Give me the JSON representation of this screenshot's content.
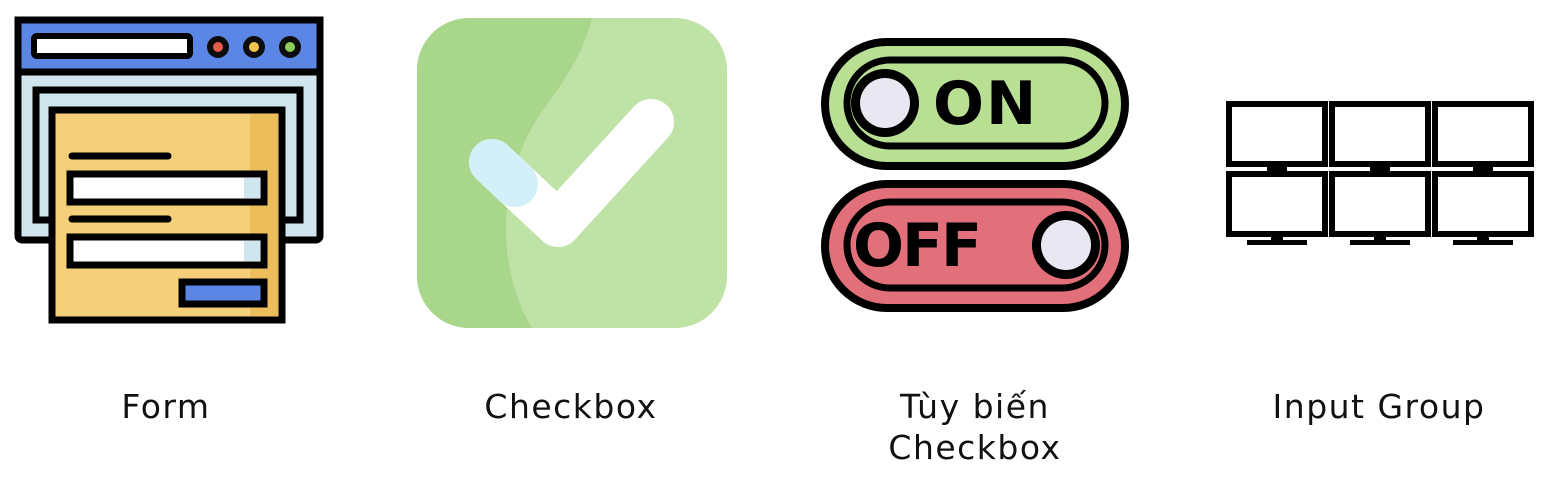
{
  "items": [
    {
      "label": "Form",
      "icon": "form-window-icon"
    },
    {
      "label": "Checkbox",
      "icon": "checkmark-icon"
    },
    {
      "label": "Tùy biến Checkbox",
      "icon": "on-off-toggle-icon",
      "toggle_on_text": "ON",
      "toggle_off_text": "OFF"
    },
    {
      "label": "Input Group",
      "icon": "monitor-grid-icon"
    }
  ],
  "colors": {
    "form_titlebar": "#5b86e5",
    "form_page": "#f5cf7a",
    "form_window": "#cfe6ee",
    "check_bg": "#bfe3a6",
    "check_shade": "#a8d68a",
    "toggle_on": "#b9df93",
    "toggle_off": "#e2707a",
    "outline": "#000000"
  }
}
